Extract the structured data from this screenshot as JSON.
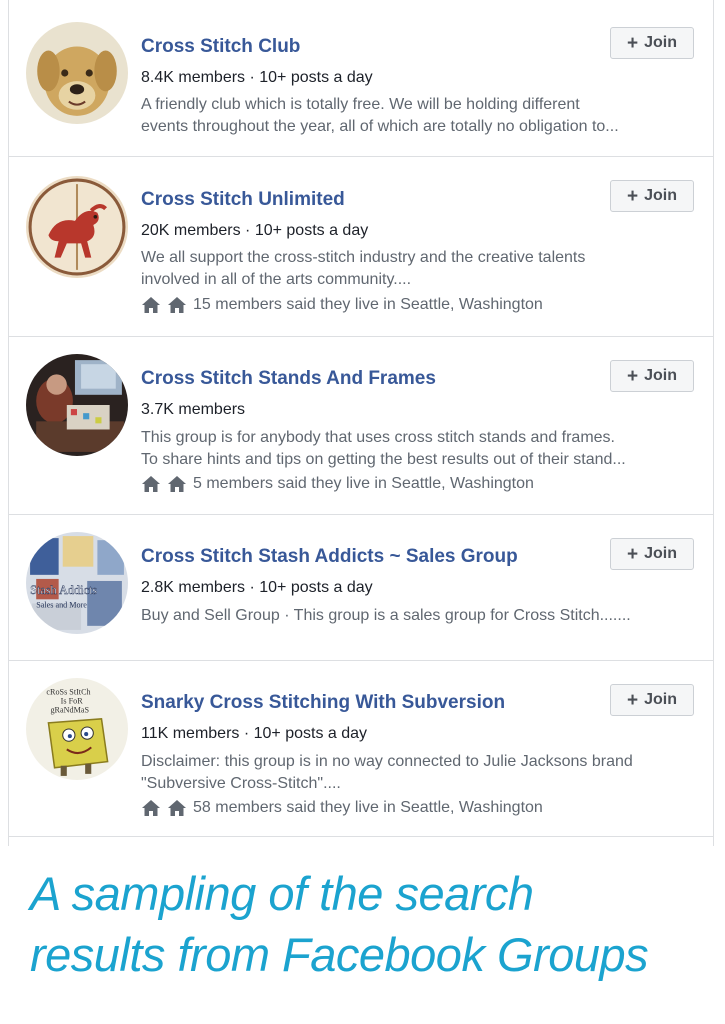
{
  "groups": [
    {
      "name": "Cross Stitch Club",
      "stats": "8.4K members · 10+ posts a day",
      "description_lines": [
        "A friendly club which is totally free. We will be holding different",
        "events throughout the year, all of which are totally no obligation to..."
      ],
      "residents": "",
      "join_label": "Join",
      "avatar_icon": "dog-embroidery-avatar"
    },
    {
      "name": "Cross Stitch Unlimited",
      "stats": "20K members · 10+ posts a day",
      "description_lines": [
        "We all support the cross-stitch industry and the creative talents",
        "involved in all of the arts community...."
      ],
      "residents": "15 members said they live in Seattle, Washington",
      "join_label": "Join",
      "avatar_icon": "carousel-horse-avatar"
    },
    {
      "name": "Cross Stitch Stands And Frames",
      "stats": "3.7K members",
      "description_lines": [
        "This group is for anybody that uses cross stitch stands and frames.",
        "To share hints and tips on getting the best results out of their stand..."
      ],
      "residents": "5 members said they live in Seattle, Washington",
      "join_label": "Join",
      "avatar_icon": "stitching-desk-avatar"
    },
    {
      "name": "Cross Stitch Stash Addicts ~ Sales Group",
      "stats": "2.8K members · 10+ posts a day",
      "description_lines": [
        "Buy and Sell Group · This group is a sales group for Cross Stitch......."
      ],
      "residents": "",
      "join_label": "Join",
      "avatar_icon": "stash-addicts-avatar",
      "avatar_text_1": "Stash Addicts",
      "avatar_text_2": "Sales and More"
    },
    {
      "name": "Snarky Cross Stitching With Subversion",
      "stats": "11K members · 10+ posts a day",
      "description_lines": [
        "Disclaimer: this group is in no way connected to Julie Jacksons brand",
        "\"Subversive Cross-Stitch\"...."
      ],
      "residents": "58 members said they live in Seattle, Washington",
      "join_label": "Join",
      "avatar_icon": "cartoon-sponge-avatar",
      "avatar_text_1": "cRoSs StItCh",
      "avatar_text_2": "Is FoR",
      "avatar_text_3": "gRaNdMaS"
    }
  ],
  "caption": {
    "line1": "A sampling of the search",
    "line2": "results from Facebook Groups"
  },
  "colors": {
    "group_name": "#385898",
    "caption": "#1ba3cf",
    "secondary_text": "#606770",
    "button_bg": "#f5f6f7",
    "divider": "#dddfe2"
  },
  "icons": {
    "home": "home-icon",
    "plus": "plus-icon"
  }
}
